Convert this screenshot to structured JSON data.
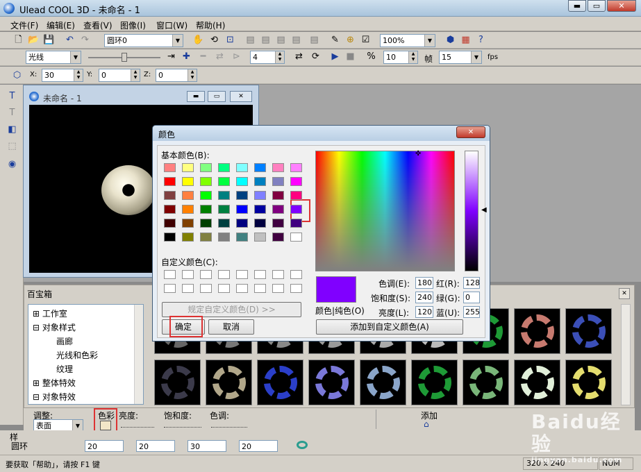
{
  "app": {
    "title": "Ulead COOL 3D - 未命名 - 1",
    "min": "▬",
    "max": "▭",
    "close": "✕"
  },
  "menu": [
    "文件(F)",
    "编辑(E)",
    "查看(V)",
    "图像(I)",
    "窗口(W)",
    "帮助(H)"
  ],
  "toolbar1": {
    "object_combo": "圆环0",
    "zoom_combo": "100%"
  },
  "toolbar2": {
    "light_combo": "光线",
    "steps": "4",
    "frame_value": "10",
    "frame_label": "帧",
    "fps_value": "15",
    "fps_label": "fps"
  },
  "toolbar3": {
    "x_label": "X:",
    "x": "30",
    "y_label": "Y:",
    "y": "0",
    "z_label": "Z:",
    "z": "0"
  },
  "child_window": {
    "title": "未命名 - 1"
  },
  "gallery": {
    "title": "百宝箱",
    "tree": [
      "工作室",
      "对象样式",
      "画廊",
      "光线和色彩",
      "纹理",
      "整体特效",
      "对象特效"
    ],
    "thumb_colors": [
      "#c77a6f",
      "#3b4fb8",
      "#3b3a4a",
      "#b1a78a",
      "#2b3fc9",
      "#7a78d9",
      "#8aa5c9",
      "#1e9a36",
      "#79b679",
      "#e1efd9",
      "#e4dd6e"
    ]
  },
  "adjust": {
    "label": "调整:",
    "select": "表面",
    "color": "色彩",
    "brightness": "亮度:",
    "saturation": "饱和度:",
    "hue": "色调:",
    "add": "添加"
  },
  "bottom_row": {
    "label": "圆环",
    "v1": "20",
    "v2": "20",
    "v3": "30",
    "v4": "20"
  },
  "side_label": "样",
  "status": {
    "help": "要获取「帮助」，请按 F1 键",
    "size": "320 x 240",
    "num": "NUM"
  },
  "dialog": {
    "title": "颜色",
    "close": "✕",
    "basic_label": "基本颜色(B):",
    "basic_colors": [
      "#ff8080",
      "#ffff80",
      "#80ff80",
      "#00ff80",
      "#80ffff",
      "#0080ff",
      "#ff80c0",
      "#ff80ff",
      "#ff0000",
      "#ffff00",
      "#80ff00",
      "#00ff40",
      "#00ffff",
      "#0080c0",
      "#8080c0",
      "#ff00ff",
      "#804040",
      "#ff8040",
      "#00ff00",
      "#008080",
      "#004080",
      "#8080ff",
      "#800040",
      "#ff0080",
      "#800000",
      "#ff8000",
      "#008000",
      "#008040",
      "#0000ff",
      "#0000a0",
      "#800080",
      "#8000ff",
      "#400000",
      "#804000",
      "#004000",
      "#004040",
      "#000080",
      "#000040",
      "#400040",
      "#400080",
      "#000000",
      "#808000",
      "#808040",
      "#808080",
      "#408080",
      "#c0c0c0",
      "#400040",
      "#ffffff"
    ],
    "custom_label": "自定义颜色(C):",
    "define_custom": "规定自定义颜色(D) >>",
    "ok": "确定",
    "cancel": "取消",
    "preview_label": "颜色|纯色(O)",
    "hue_label": "色调(E):",
    "hue": "180",
    "sat_label": "饱和度(S):",
    "sat": "240",
    "lum_label": "亮度(L):",
    "lum": "120",
    "red_label": "红(R):",
    "red": "128",
    "green_label": "绿(G):",
    "green": "0",
    "blue_label": "蓝(U):",
    "blue": "255",
    "add_custom": "添加到自定义颜色(A)",
    "selected_color": "#8000ff"
  },
  "watermark": "Baidu经验",
  "watermark_sub": "jingyan.baidu.com"
}
